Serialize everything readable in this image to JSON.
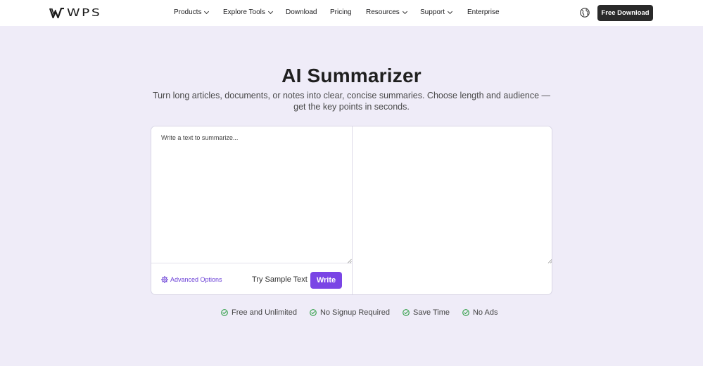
{
  "header": {
    "logo_text": "WPS",
    "nav": [
      {
        "label": "Products",
        "dropdown": true
      },
      {
        "label": "Explore Tools",
        "dropdown": true
      },
      {
        "label": "Download",
        "dropdown": false
      },
      {
        "label": "Pricing",
        "dropdown": false
      },
      {
        "label": "Resources",
        "dropdown": true
      },
      {
        "label": "Support",
        "dropdown": true
      },
      {
        "label": "Enterprise",
        "dropdown": false
      }
    ],
    "globe_icon": "globe-icon",
    "cta_label": "Free Download"
  },
  "hero": {
    "title": "AI Summarizer",
    "subtitle": "Turn long articles, documents, or notes into clear, concise summaries. Choose length and audience — get the key points in seconds."
  },
  "editor": {
    "input_placeholder": "Write a text to summarize...",
    "advanced_label": "Advanced Options",
    "advanced_icon": "gear-icon",
    "sample_label": "Try Sample Text",
    "write_label": "Write"
  },
  "features": [
    {
      "label": "Free and Unlimited",
      "icon": "check-circle-icon"
    },
    {
      "label": "No Signup Required",
      "icon": "check-circle-icon"
    },
    {
      "label": "Save Time",
      "icon": "check-circle-icon"
    },
    {
      "label": "No Ads",
      "icon": "check-circle-icon"
    }
  ],
  "colors": {
    "page_background": "#efecf8",
    "accent": "#7a45e5",
    "check_green": "#2e9e45",
    "cta_dark": "#2a2a2a"
  }
}
